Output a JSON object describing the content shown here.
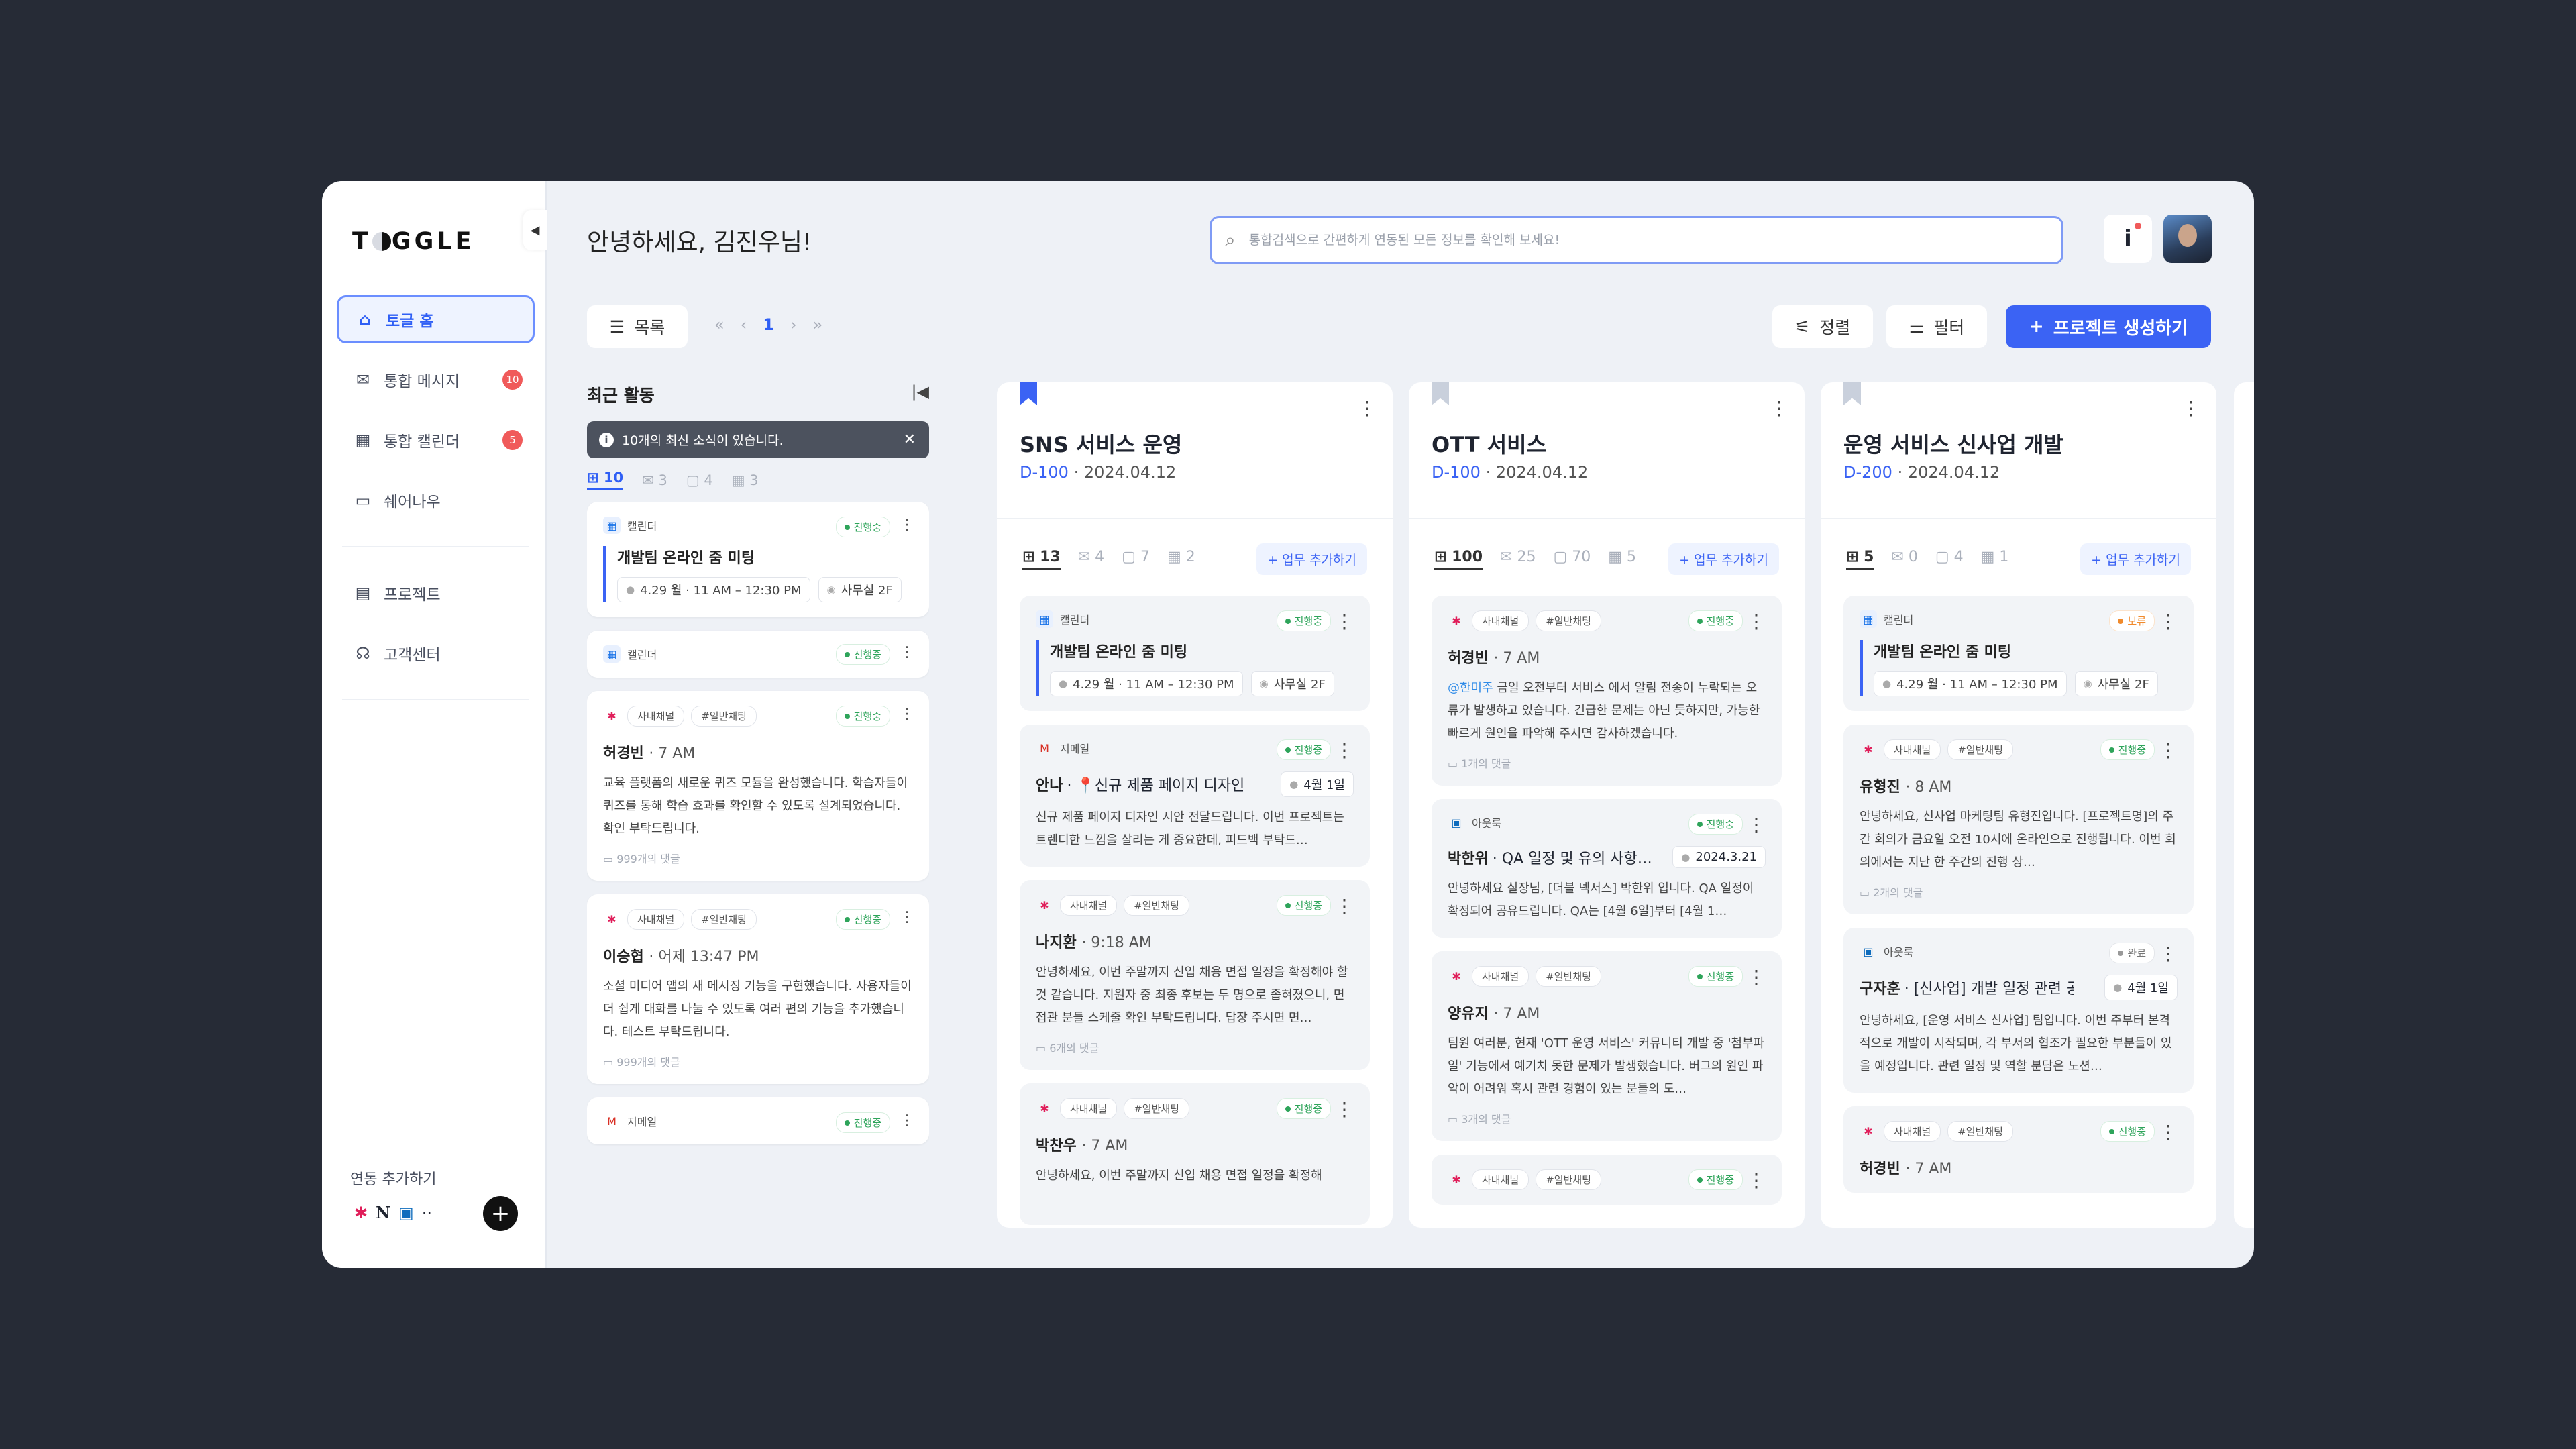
{
  "app": {
    "logo": "T",
    "logo_rest": "GGLE",
    "greeting": "안녕하세요, 김진우님!",
    "search_placeholder": "통합검색으로 간편하게 연동된 모든 정보를 확인해 보세요!",
    "info_label": "i"
  },
  "sidebar": {
    "items": [
      {
        "label": "토글 홈",
        "icon": "home-icon"
      },
      {
        "label": "통합 메시지",
        "icon": "mail-icon",
        "badge": "10"
      },
      {
        "label": "통합 캘린더",
        "icon": "calendar-icon",
        "badge": "5"
      },
      {
        "label": "쉐어나우",
        "icon": "folder-share-icon"
      },
      {
        "label": "프로젝트",
        "icon": "project-icon"
      },
      {
        "label": "고객센터",
        "icon": "headset-icon"
      }
    ],
    "integration_label": "연동 추가하기",
    "add_label": "+"
  },
  "toolbar": {
    "list_label": "목록",
    "page": "1",
    "sort_label": "정렬",
    "filter_label": "필터",
    "create_label": "프로젝트 생성하기"
  },
  "recent": {
    "title": "최근 활동",
    "notice": "10개의 최신 소식이 있습니다.",
    "counts": [
      "10",
      "3",
      "4",
      "3"
    ],
    "cards": [
      {
        "source": "캘린더",
        "status": "진행중",
        "event": "개발팀 온라인 줌 미팅",
        "time": "4.29 월 · 11 AM – 12:30 PM",
        "place": "사무실 2F"
      },
      {
        "source": "캘린더",
        "status": "진행중"
      },
      {
        "tags": [
          "사내채널",
          "#일반채팅"
        ],
        "status": "진행중",
        "name": "허경빈",
        "when": "· 7 AM",
        "body": "교육 플랫폼의 새로운 퀴즈 모듈을 완성했습니다. 학습자들이 퀴즈를 통해 학습 효과를 확인할 수 있도록 설계되었습니다. 확인 부탁드립니다.",
        "comments": "999개의 댓글"
      },
      {
        "tags": [
          "사내채널",
          "#일반채팅"
        ],
        "status": "진행중",
        "name": "이승협",
        "when": "· 어제 13:47 PM",
        "body": "소셜 미디어 앱의 새 메시징 기능을 구현했습니다. 사용자들이 더 쉽게 대화를 나눌 수 있도록 여러 편의 기능을 추가했습니다. 테스트 부탁드립니다.",
        "comments": "999개의 댓글"
      },
      {
        "source": "지메일",
        "status": "진행중"
      }
    ]
  },
  "projects": [
    {
      "title": "SNS 서비스 운영",
      "dday": "D-100",
      "date": "· 2024.04.12",
      "bookmark": "#3b63f4",
      "counts": [
        "13",
        "4",
        "7",
        "2"
      ],
      "add_label": "+ 업무 추가하기",
      "cards": [
        {
          "kind": "cal",
          "source": "캘린더",
          "status": "진행중",
          "event": "개발팀 온라인 줌 미팅",
          "time": "4.29 월 · 11 AM – 12:30 PM",
          "place": "사무실 2F"
        },
        {
          "kind": "mail",
          "source": "지메일",
          "status": "진행중",
          "sender": "안나",
          "subject": "· 📍신규 제품 페이지 디자인 시…",
          "date": "4월 1일",
          "body": "신규 제품 페이지 디자인 시안 전달드립니다. 이번 프로젝트는 트렌디한 느낌을 살리는 게 중요한데, 피드백 부탁드…"
        },
        {
          "kind": "chat",
          "tags": [
            "사내채널",
            "#일반채팅"
          ],
          "status": "진행중",
          "name": "나지환",
          "when": "· 9:18 AM",
          "body": "안녕하세요, 이번 주말까지 신입 채용 면접 일정을 확정해야 할 것 같습니다. 지원자 중 최종 후보는 두 명으로 좁혀졌으니, 면접관 분들 스케줄 확인 부탁드립니다. 답장 주시면 면…",
          "comments": "6개의 댓글"
        },
        {
          "kind": "chat",
          "tags": [
            "사내채널",
            "#일반채팅"
          ],
          "status": "진행중",
          "name": "박찬우",
          "when": "· 7 AM",
          "body": "안녕하세요, 이번 주말까지 신입 채용 면접 일정을 확정해"
        }
      ]
    },
    {
      "title": "OTT 서비스",
      "dday": "D-100",
      "date": "· 2024.04.12",
      "bookmark": "#c9d0dc",
      "counts": [
        "100",
        "25",
        "70",
        "5"
      ],
      "add_label": "+ 업무 추가하기",
      "cards": [
        {
          "kind": "chat",
          "tags": [
            "사내채널",
            "#일반채팅"
          ],
          "status": "진행중",
          "name": "허경빈",
          "when": "· 7 AM",
          "mention": "@한미주",
          "body": " 금일 오전부터 서비스 에서 알림 전송이 누락되는 오류가 발생하고 있습니다. 긴급한 문제는 아닌 듯하지만, 가능한 빠르게 원인을 파악해 주시면 감사하겠습니다.",
          "comments": "1개의 댓글"
        },
        {
          "kind": "mail",
          "source": "아웃룩",
          "status": "진행중",
          "sender": "박한위",
          "subject": "· QA 일정 및 유의 사항…",
          "date": "2024.3.21",
          "body": "안녕하세요 실장님, [더블 넥서스] 박한위 입니다. QA 일정이 확정되어 공유드립니다. QA는 [4월 6일]부터 [4월 1…"
        },
        {
          "kind": "chat",
          "tags": [
            "사내채널",
            "#일반채팅"
          ],
          "status": "진행중",
          "name": "양유지",
          "when": "· 7 AM",
          "body": "팀원 여러분, 현재 'OTT 운영 서비스' 커뮤니티 개발 중 '첨부파일' 기능에서 예기치 못한 문제가 발생했습니다. 버그의 원인 파악이 어려워 혹시 관련 경험이 있는 분들의 도…",
          "comments": "3개의 댓글"
        },
        {
          "kind": "chat",
          "tags": [
            "사내채널",
            "#일반채팅"
          ],
          "status": "진행중",
          "name": "",
          "when": "",
          "body": ""
        }
      ]
    },
    {
      "title": "운영 서비스 신사업 개발",
      "dday": "D-200",
      "date": "· 2024.04.12",
      "bookmark": "#c9d0dc",
      "counts": [
        "5",
        "0",
        "4",
        "1"
      ],
      "add_label": "+ 업무 추가하기",
      "cards": [
        {
          "kind": "cal",
          "source": "캘린더",
          "status": "보류",
          "status_kind": "hold",
          "event": "개발팀 온라인 줌 미팅",
          "time": "4.29 월 · 11 AM – 12:30 PM",
          "place": "사무실 2F"
        },
        {
          "kind": "chat",
          "tags": [
            "사내채널",
            "#일반채팅"
          ],
          "status": "진행중",
          "name": "유형진",
          "when": "· 8 AM",
          "body": "안녕하세요, 신사업 마케팅팀 유형진입니다. [프로젝트명]의 주간 회의가 금요일 오전 10시에 온라인으로 진행됩니다. 이번 회의에서는 지난 한 주간의 진행 상…",
          "comments": "2개의 댓글"
        },
        {
          "kind": "mail",
          "source": "아웃룩",
          "status": "완료",
          "status_kind": "done",
          "sender": "구자훈",
          "subject": "· [신사업] 개발 일정 관련 공지",
          "date": "4월 1일",
          "body": "안녕하세요, [운영 서비스 신사업] 팀입니다. 이번 주부터 본격적으로 개발이 시작되며, 각 부서의 협조가 필요한 부분들이 있을 예정입니다. 관련 일정 및 역할 분담은 노션…"
        },
        {
          "kind": "chat",
          "tags": [
            "사내채널",
            "#일반채팅"
          ],
          "status": "진행중",
          "name": "허경빈",
          "when": "· 7 AM",
          "body": ""
        }
      ]
    }
  ],
  "colors": {
    "accent": "#3b63f4",
    "badge": "#f05a5a",
    "status_green": "#2ea45a",
    "status_hold": "#f08a2c",
    "mention": "#2f8be8"
  }
}
